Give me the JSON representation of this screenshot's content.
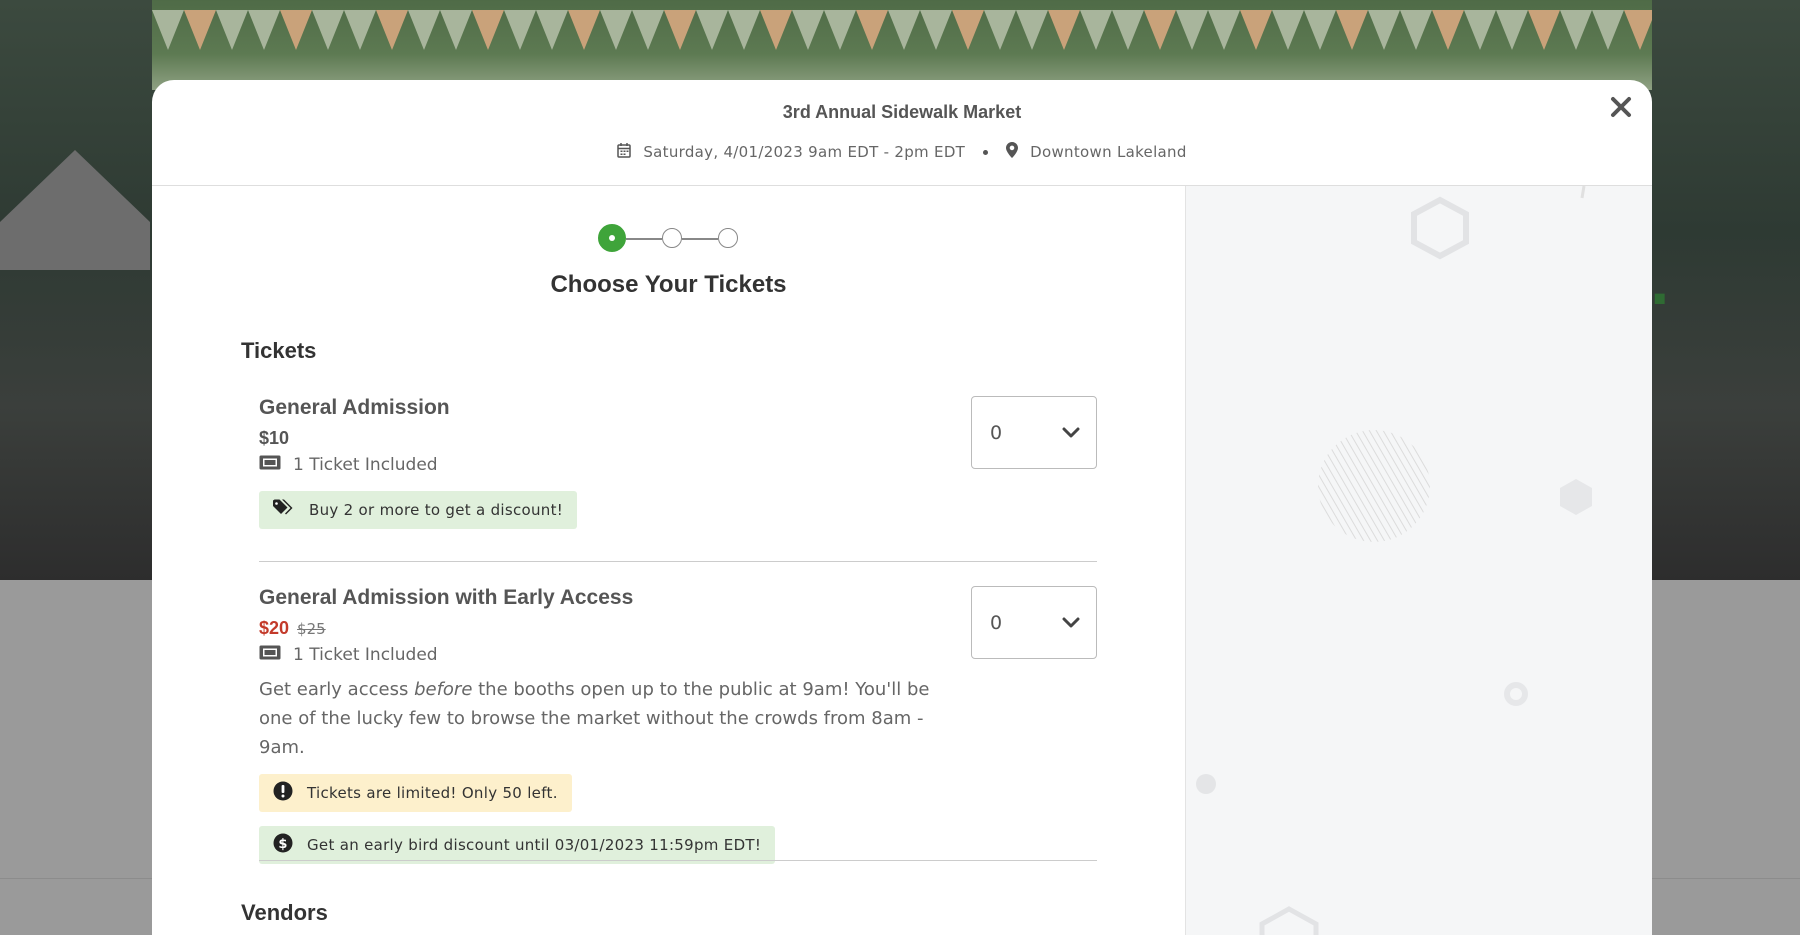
{
  "event": {
    "title": "3rd Annual Sidewalk Market",
    "datetime": "Saturday, 4/01/2023 9am EDT - 2pm EDT",
    "location": "Downtown Lakeland"
  },
  "stepper": {
    "steps": 3,
    "current": 1
  },
  "step_heading": "Choose Your Tickets",
  "sections": {
    "tickets_title": "Tickets",
    "vendors_title": "Vendors"
  },
  "tickets": [
    {
      "name": "General Admission",
      "price": "$10",
      "included": "1 Ticket Included",
      "badge": "Buy 2 or more to get a discount!",
      "quantity": "0"
    },
    {
      "name": "General Admission with Early Access",
      "price": "$20",
      "original_price": "$25",
      "included": "1 Ticket Included",
      "description_before": "Get early access ",
      "description_em": "before",
      "description_after": " the booths open up to the public at 9am! You'll be one of the lucky few to browse the market without the crowds from 8am - 9am.",
      "notice": "Tickets are limited! Only 50 left.",
      "badge": "Get an early bird discount until 03/01/2023 11:59pm EDT!",
      "quantity": "0"
    }
  ],
  "colors": {
    "accent": "#3fa43a",
    "sale": "#c33a2a",
    "badge_green": "#e0f0dc",
    "badge_yellow": "#fdf0cc"
  },
  "icons": [
    "calendar-icon",
    "map-pin-icon",
    "close-icon",
    "ticket-icon",
    "tags-icon",
    "chevron-down-icon",
    "exclamation-icon",
    "dollar-icon"
  ]
}
